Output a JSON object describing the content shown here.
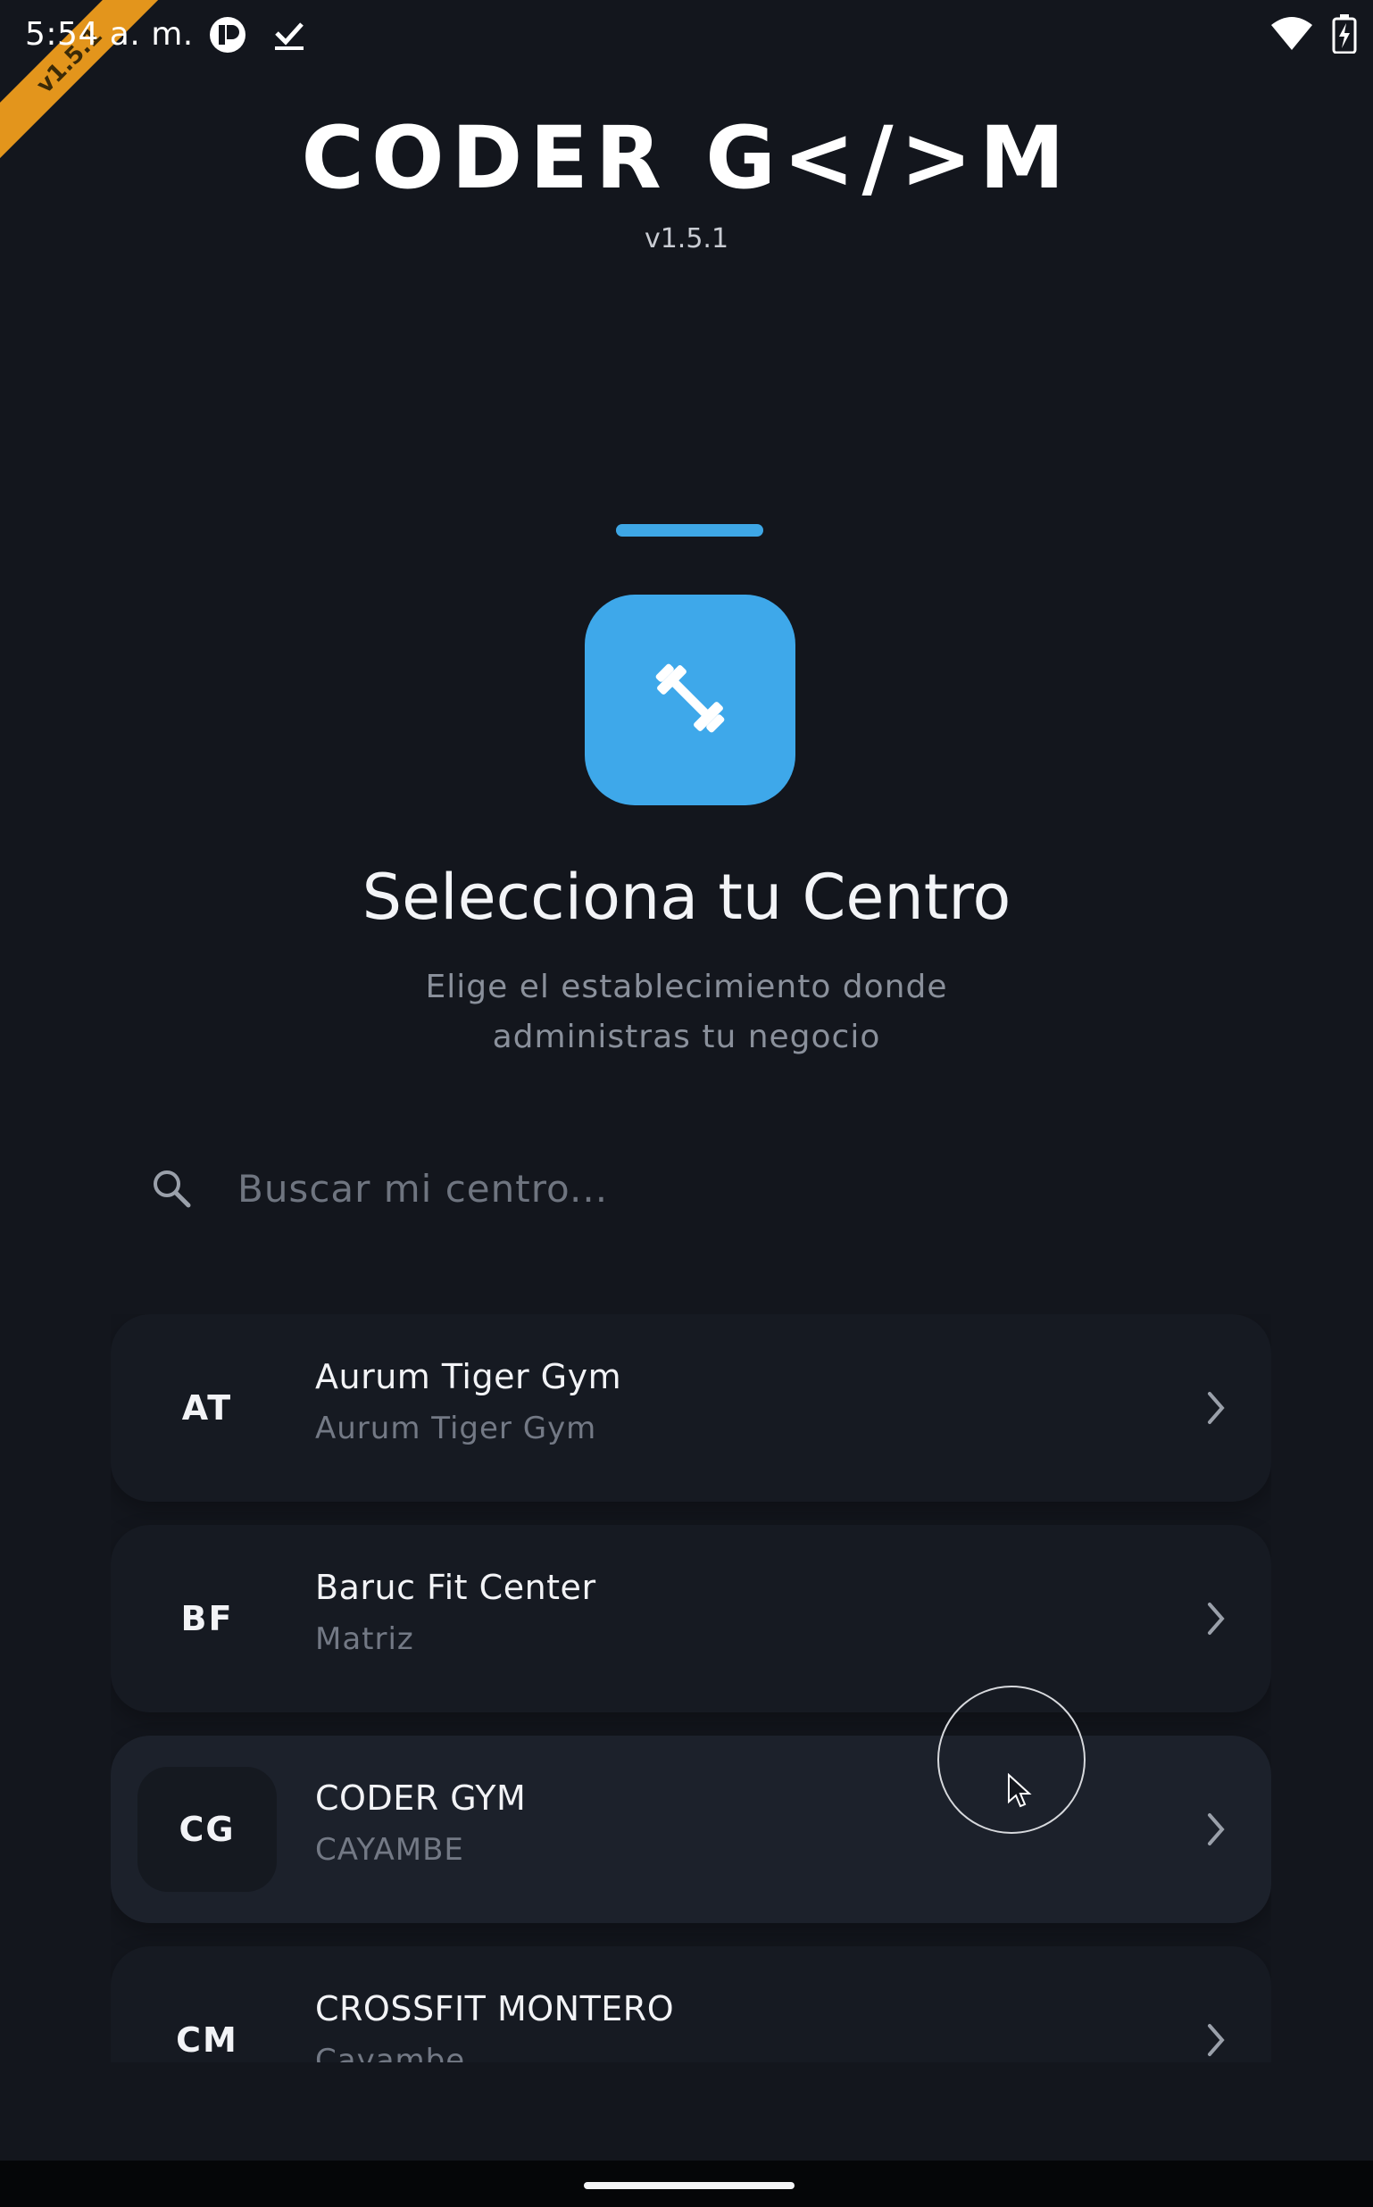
{
  "status_bar": {
    "time": "5:54 a. m.",
    "icons": [
      "app-notification-icon",
      "download-complete-icon",
      "wifi-icon",
      "battery-charging-icon"
    ]
  },
  "debug_banner": {
    "label": "v1.5.1"
  },
  "header": {
    "brand": "CODER G</>M",
    "version": "v1.5.1"
  },
  "hero": {
    "icon": "dumbbell-icon",
    "title": "Selecciona tu Centro",
    "subtitle": "Elige el establecimiento donde administras tu negocio"
  },
  "search": {
    "icon": "search-icon",
    "placeholder": "Buscar mi centro...",
    "value": ""
  },
  "centers": [
    {
      "initials": "AT",
      "name": "Aurum Tiger Gym",
      "subtitle": "Aurum Tiger Gym"
    },
    {
      "initials": "BF",
      "name": "Baruc Fit Center",
      "subtitle": "Matriz"
    },
    {
      "initials": "CG",
      "name": "CODER GYM",
      "subtitle": "CAYAMBE",
      "selected": true
    },
    {
      "initials": "CM",
      "name": "CROSSFIT MONTERO",
      "subtitle": "Cayambe"
    }
  ],
  "colors": {
    "background": "#13161d",
    "accent": "#3ea8ea",
    "debug_ribbon": "#e3951c"
  }
}
